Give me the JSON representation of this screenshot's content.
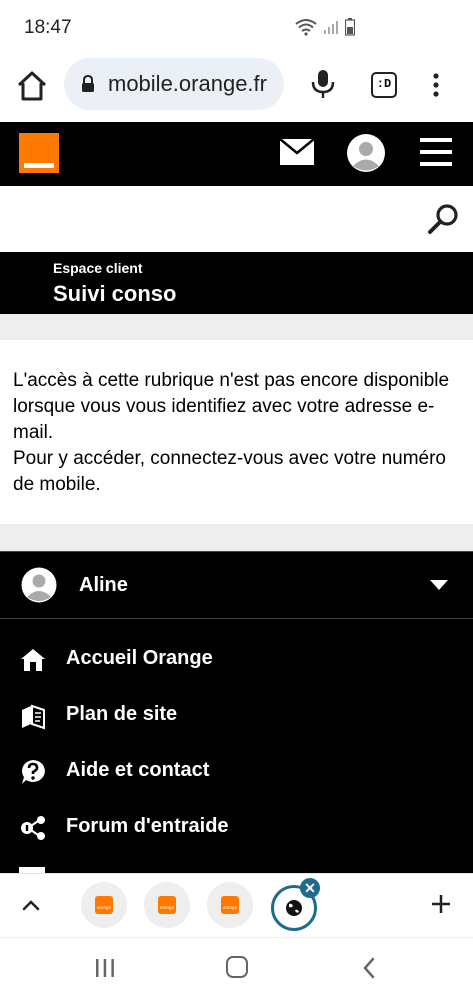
{
  "status_bar": {
    "time": "18:47",
    "icons": [
      "wifi-icon",
      "signal-icon",
      "battery-icon"
    ]
  },
  "browser": {
    "url": "mobile.orange.fr",
    "tabs_badge": ":D",
    "icons": [
      "home-icon",
      "lock-icon",
      "mic-icon",
      "overflow-menu-icon"
    ]
  },
  "site_header": {
    "brand_color": "#ff7900",
    "icons": [
      "orange-logo",
      "mail-icon",
      "account-avatar-icon",
      "hamburger-menu-icon",
      "search-icon"
    ]
  },
  "page_title": {
    "subtitle": "Espace client",
    "title": "Suivi conso"
  },
  "message": {
    "line1": "L'accès à cette rubrique n'est pas encore disponible lorsque vous vous identifiez avec votre adresse e-mail.",
    "line2": "Pour y accéder, connectez-vous avec votre numéro de mobile."
  },
  "user": {
    "name": "Aline"
  },
  "nav": {
    "items": [
      {
        "label": "Accueil Orange",
        "icon": "home-icon"
      },
      {
        "label": "Plan de site",
        "icon": "sitemap-icon"
      },
      {
        "label": "Aide et contact",
        "icon": "help-icon"
      },
      {
        "label": "Forum d'entraide",
        "icon": "forum-icon"
      }
    ]
  },
  "tab_strip": {
    "favicon_text": "orange",
    "close_glyph": "✕",
    "accent": "#1e6b8c"
  }
}
